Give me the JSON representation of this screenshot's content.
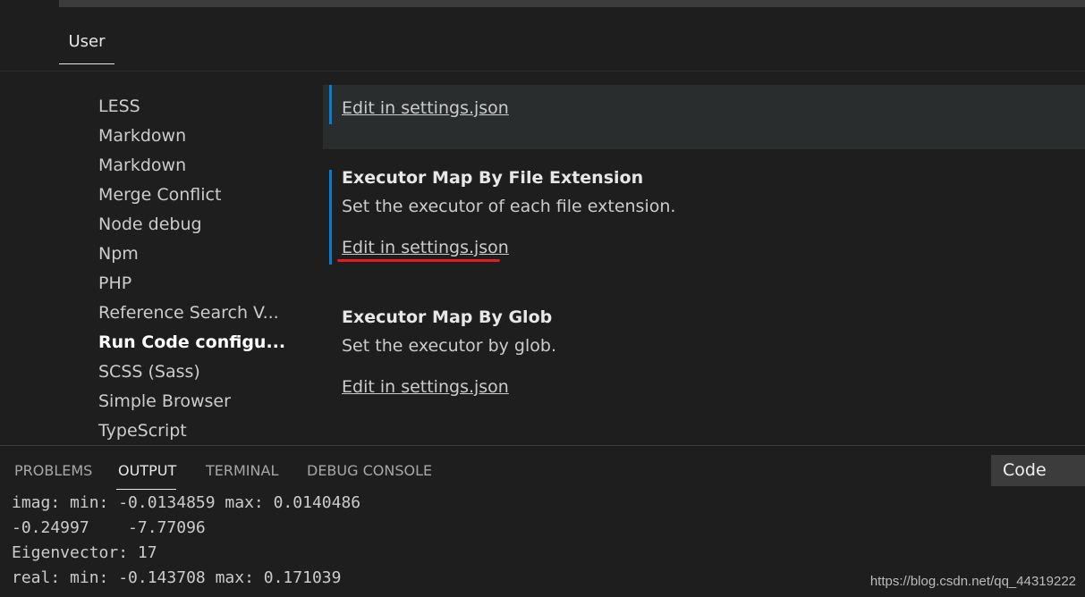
{
  "tabs": {
    "user": "User"
  },
  "toc": {
    "items": [
      "LESS",
      "Markdown",
      "Markdown",
      "Merge Conflict",
      "Node debug",
      "Npm",
      "PHP",
      "Reference Search V...",
      "Run Code configu...",
      "SCSS (Sass)",
      "Simple Browser",
      "TypeScript"
    ]
  },
  "settings": {
    "prev_link": "Edit in settings.json",
    "executor_map_ext": {
      "title": "Executor Map By File Extension",
      "description": "Set the executor of each file extension.",
      "link": "Edit in settings.json"
    },
    "executor_map_glob": {
      "title": "Executor Map By Glob",
      "description": "Set the executor by glob.",
      "link": "Edit in settings.json"
    }
  },
  "panel": {
    "tabs": [
      "PROBLEMS",
      "OUTPUT",
      "TERMINAL",
      "DEBUG CONSOLE"
    ],
    "active_tab": "OUTPUT",
    "output_selector": "Code",
    "output_lines": [
      "imag: min: -0.0134859 max: 0.0140486",
      "-0.24997    -7.77096",
      "Eigenvector: 17",
      "real: min: -0.143708 max: 0.171039"
    ]
  },
  "watermark": "https://blog.csdn.net/qq_44319222",
  "colors": {
    "accent": "#007fd4",
    "highlight_underline": "#e51c23"
  }
}
